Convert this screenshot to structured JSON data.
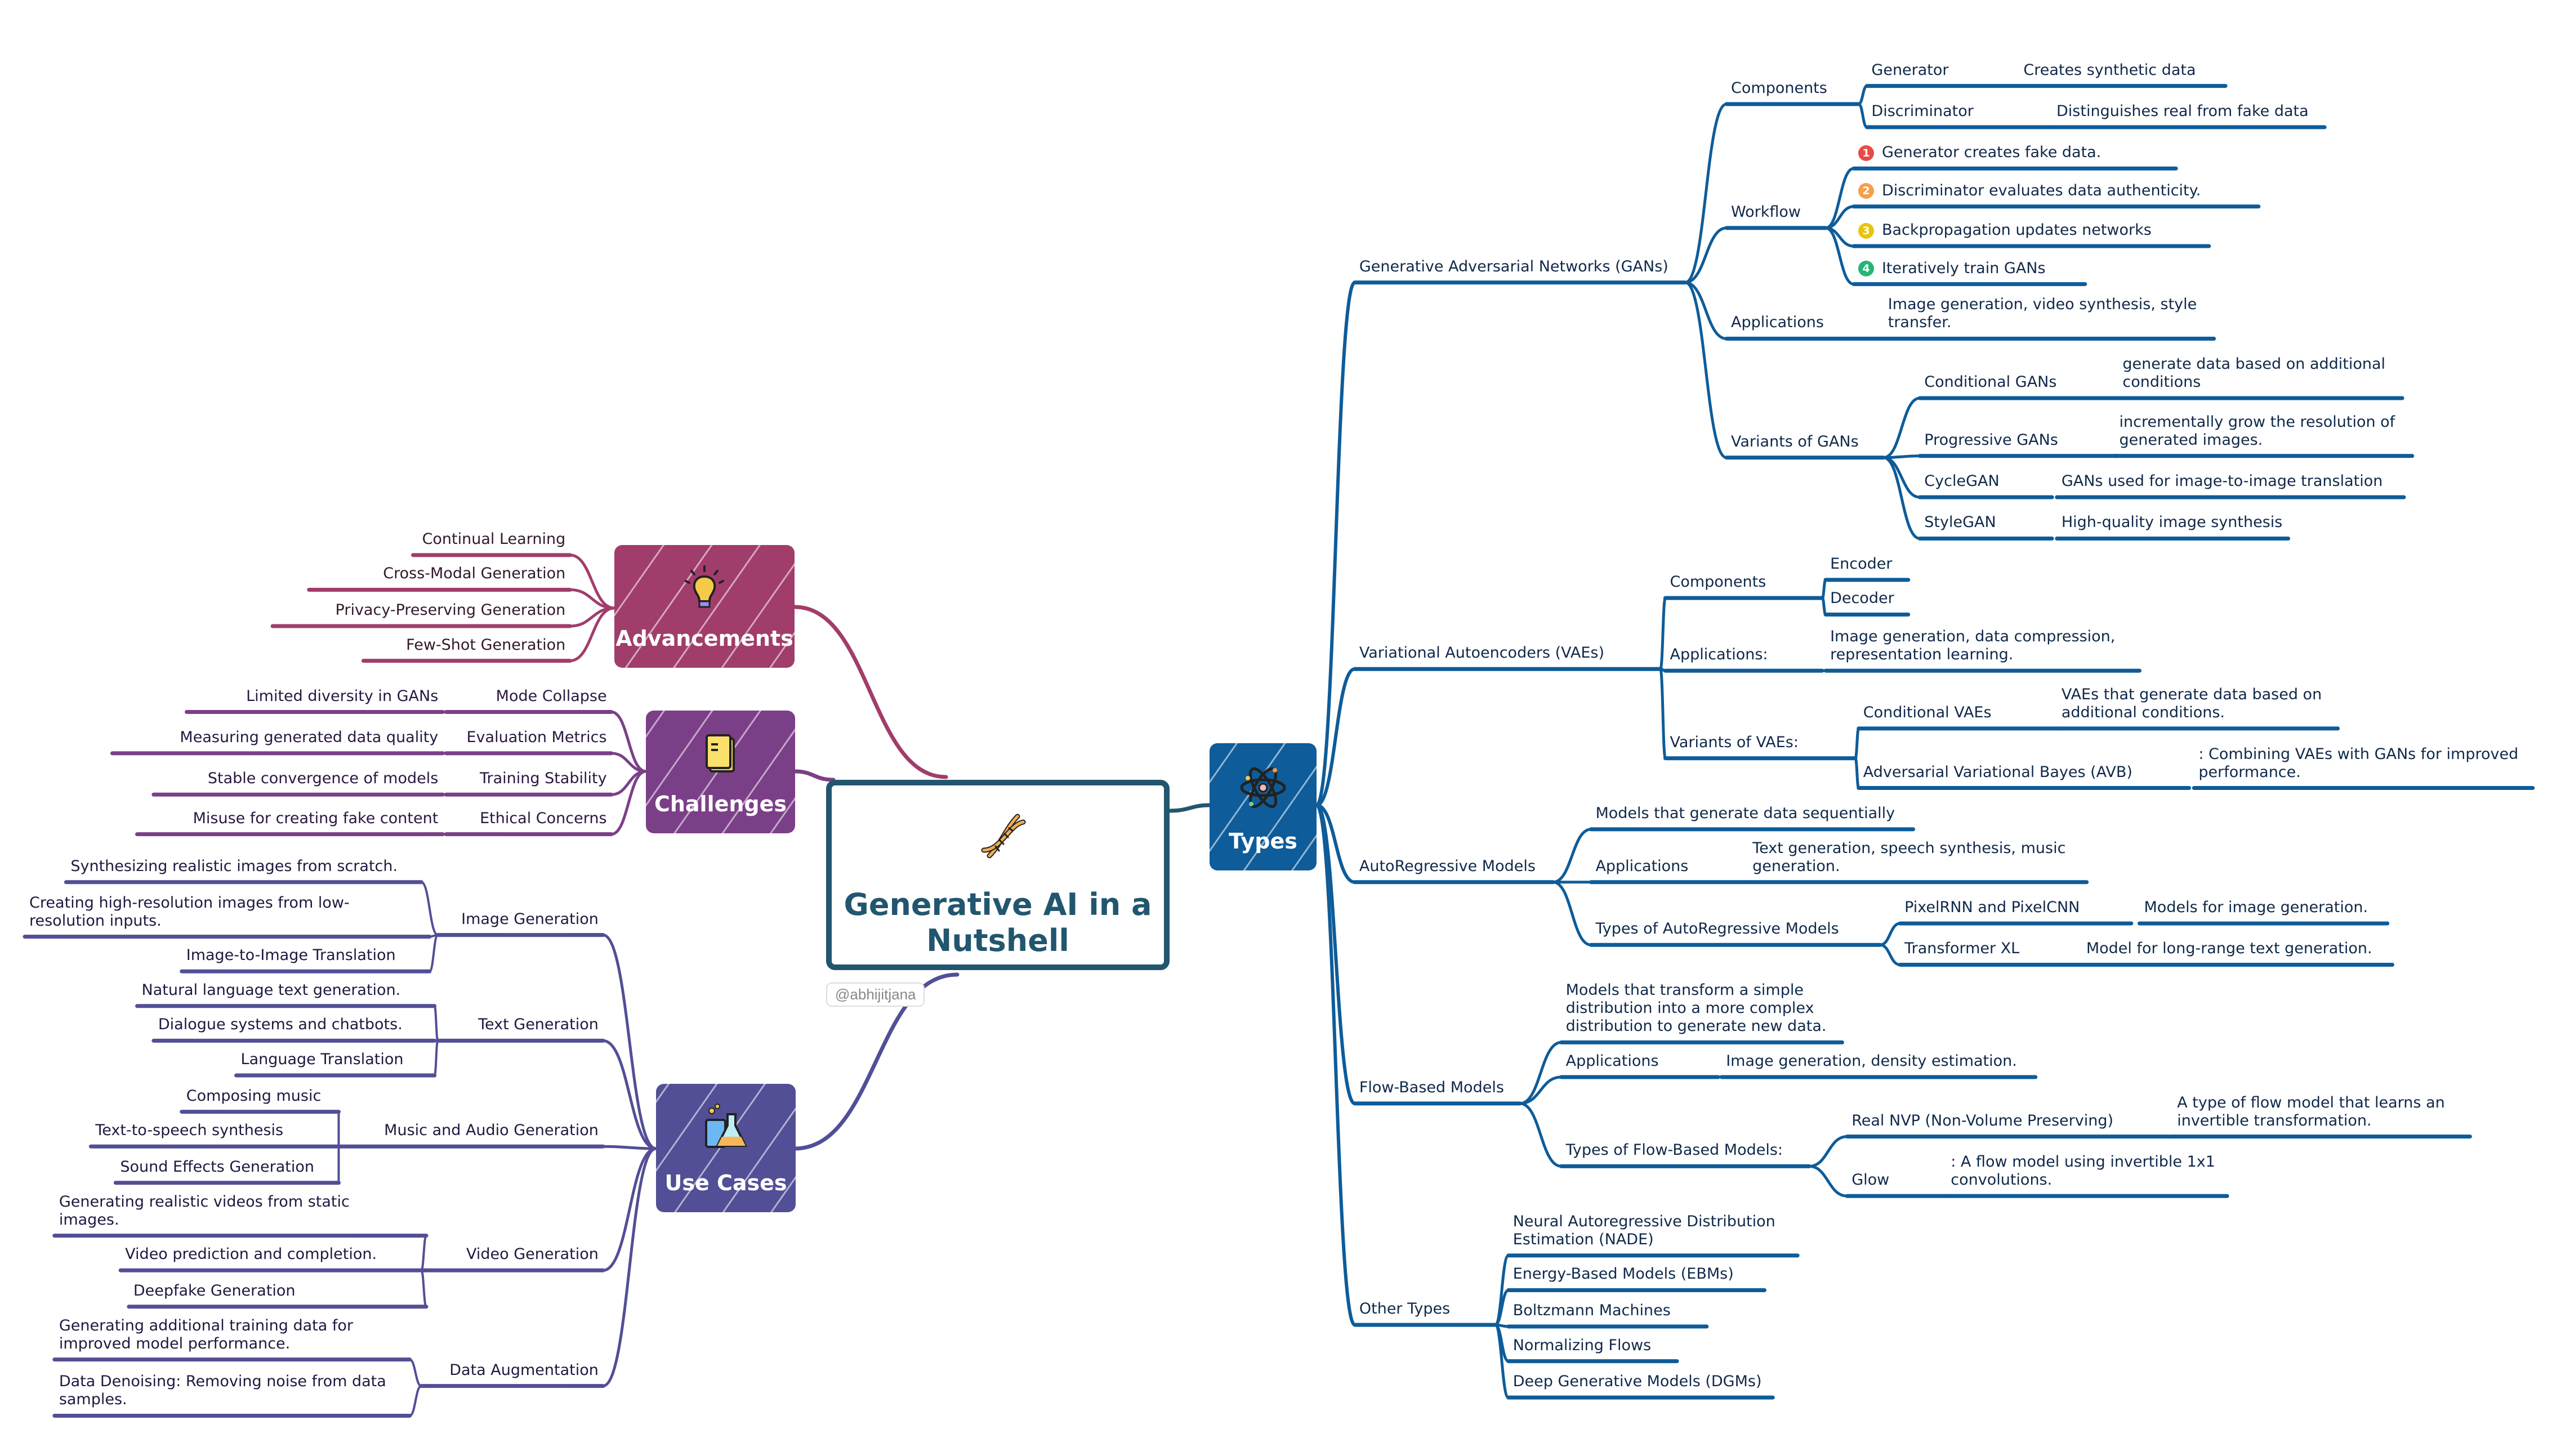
{
  "center": {
    "title": "Generative AI in a Nutshell",
    "icon": "dna-icon",
    "credit": "@abhijitjana"
  },
  "colors": {
    "types": "#0e5c99",
    "advancements": "#a13d6b",
    "challenges": "#7b3f87",
    "use_cases": "#524f96",
    "center": "#22566f"
  },
  "types": {
    "label": "Types",
    "icon": "atom-icon",
    "gans": {
      "label": "Generative Adversarial Networks (GANs)",
      "components": {
        "label": "Components",
        "items": [
          {
            "name": "Generator",
            "desc": "Creates synthetic data"
          },
          {
            "name": "Discriminator",
            "desc": "Distinguishes real from fake data"
          }
        ]
      },
      "workflow": {
        "label": "Workflow",
        "steps": [
          {
            "num": "1",
            "color": "#e94a47",
            "text": "Generator creates fake data."
          },
          {
            "num": "2",
            "color": "#f5a04a",
            "text": "Discriminator evaluates data authenticity."
          },
          {
            "num": "3",
            "color": "#e8c40f",
            "text": "Backpropagation updates networks"
          },
          {
            "num": "4",
            "color": "#26b575",
            "text": "Iteratively train GANs"
          }
        ]
      },
      "applications": {
        "label": "Applications",
        "text": "Image generation, video synthesis, style\ntransfer."
      },
      "variants": {
        "label": "Variants of GANs",
        "items": [
          {
            "name": "Conditional GANs",
            "desc": "generate data based on additional\nconditions"
          },
          {
            "name": "Progressive GANs",
            "desc": "incrementally grow the resolution of\ngenerated images."
          },
          {
            "name": "CycleGAN",
            "desc": "GANs used for image-to-image translation"
          },
          {
            "name": "StyleGAN",
            "desc": "High-quality image synthesis"
          }
        ]
      }
    },
    "vaes": {
      "label": "Variational Autoencoders (VAEs)",
      "components": {
        "label": "Components",
        "items": [
          "Encoder",
          "Decoder"
        ]
      },
      "applications": {
        "label": "Applications:",
        "text": "Image generation, data compression,\nrepresentation learning."
      },
      "variants": {
        "label": "Variants of VAEs:",
        "items": [
          {
            "name": "Conditional VAEs",
            "desc": "VAEs that generate data based on\nadditional conditions."
          },
          {
            "name": "Adversarial Variational Bayes (AVB)",
            "desc": ": Combining VAEs with GANs for improved\nperformance."
          }
        ]
      }
    },
    "autoregressive": {
      "label": "AutoRegressive Models",
      "desc": "Models that generate data sequentially",
      "applications": {
        "label": "Applications",
        "text": "Text generation, speech synthesis, music\ngeneration."
      },
      "types": {
        "label": "Types of AutoRegressive Models",
        "items": [
          {
            "name": "PixelRNN and PixelCNN",
            "desc": "Models for image generation."
          },
          {
            "name": "Transformer XL",
            "desc": "Model for long-range text generation."
          }
        ]
      }
    },
    "flow": {
      "label": "Flow-Based Models",
      "desc": "Models that transform a simple\ndistribution into a more complex\ndistribution to generate new data.",
      "applications": {
        "label": "Applications",
        "text": "Image generation, density estimation."
      },
      "types": {
        "label": "Types of Flow-Based Models:",
        "items": [
          {
            "name": "Real NVP (Non-Volume Preserving)",
            "desc": "A type of flow model that learns an\ninvertible transformation."
          },
          {
            "name": "Glow",
            "desc": ": A flow model using invertible 1x1\nconvolutions."
          }
        ]
      }
    },
    "other": {
      "label": "Other Types",
      "items": [
        "Neural Autoregressive Distribution\nEstimation (NADE)",
        "Energy-Based Models (EBMs)",
        "Boltzmann Machines",
        "Normalizing Flows",
        "Deep Generative Models (DGMs)"
      ]
    }
  },
  "advancements": {
    "label": "Advancements",
    "icon": "lightbulb-icon",
    "items": [
      "Continual Learning",
      "Cross-Modal Generation",
      "Privacy-Preserving Generation",
      "Few-Shot Generation"
    ]
  },
  "challenges": {
    "label": "Challenges",
    "icon": "sticky-note-icon",
    "items": [
      {
        "name": "Mode Collapse",
        "desc": "Limited diversity in GANs"
      },
      {
        "name": "Evaluation Metrics",
        "desc": "Measuring generated data quality"
      },
      {
        "name": "Training Stability",
        "desc": "Stable convergence of models"
      },
      {
        "name": "Ethical Concerns",
        "desc": "Misuse for creating fake content"
      }
    ]
  },
  "use_cases": {
    "label": "Use Cases",
    "icon": "flask-icon",
    "groups": [
      {
        "name": "Image Generation",
        "items": [
          "Synthesizing realistic images from scratch.",
          "Creating high-resolution images from low-\nresolution inputs.",
          "Image-to-Image Translation"
        ]
      },
      {
        "name": "Text Generation",
        "items": [
          "Natural language text generation.",
          "Dialogue systems and chatbots.",
          "Language Translation"
        ]
      },
      {
        "name": "Music and Audio Generation",
        "items": [
          "Composing music",
          "Text-to-speech synthesis",
          "Sound Effects Generation"
        ]
      },
      {
        "name": "Video Generation",
        "items": [
          "Generating realistic videos from static\nimages.",
          "Video prediction and completion.",
          "Deepfake Generation"
        ]
      },
      {
        "name": "Data Augmentation",
        "items": [
          "Generating additional training data for\nimproved model performance.",
          "Data Denoising: Removing noise from data\nsamples."
        ]
      }
    ]
  }
}
